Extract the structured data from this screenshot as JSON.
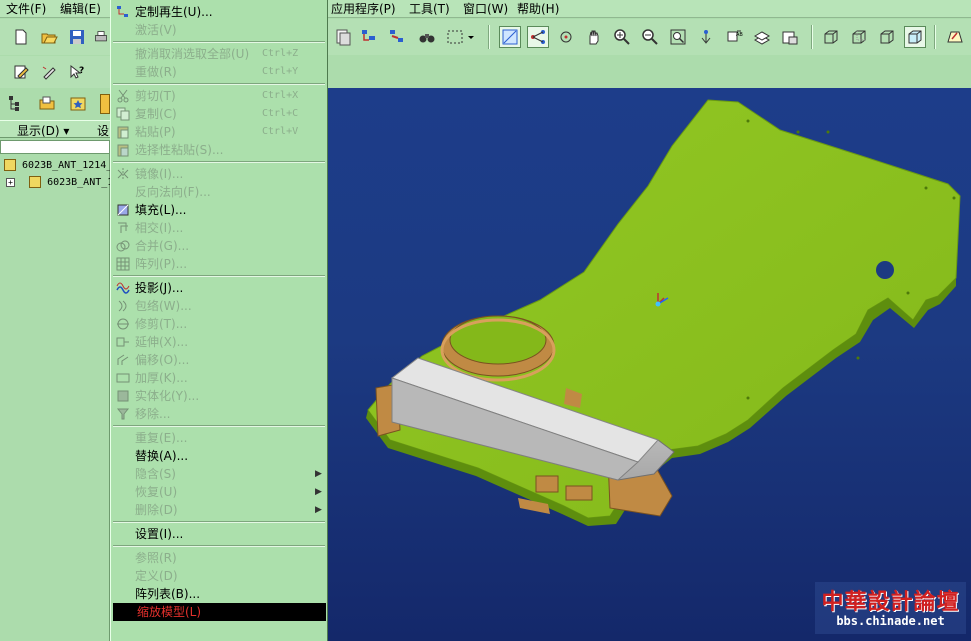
{
  "menubar": {
    "file": "文件(F)",
    "edit": "编辑(E)",
    "applications": "应用程序(P)",
    "tools": "工具(T)",
    "window": "窗口(W)",
    "help": "帮助(H)"
  },
  "left_panel": {
    "show_button": "显示(D) ▾",
    "settings_button": "设",
    "tree_items": [
      "6023B_ANT_1214_",
      "6023B_ANT_1"
    ]
  },
  "edit_menu": {
    "items": [
      {
        "label": "定制再生(U)...",
        "shortcut": "",
        "enabled": true,
        "icon": "regenerate-icon"
      },
      {
        "label": "激活(V)",
        "shortcut": "",
        "enabled": false,
        "icon": ""
      },
      {
        "sep": true
      },
      {
        "label": "撤消取消选取全部(U)",
        "shortcut": "Ctrl+Z",
        "enabled": false,
        "icon": ""
      },
      {
        "label": "重做(R)",
        "shortcut": "Ctrl+Y",
        "enabled": false,
        "icon": ""
      },
      {
        "sep": true
      },
      {
        "label": "剪切(T)",
        "shortcut": "Ctrl+X",
        "enabled": false,
        "icon": "scissors-icon"
      },
      {
        "label": "复制(C)",
        "shortcut": "Ctrl+C",
        "enabled": false,
        "icon": "copy-icon"
      },
      {
        "label": "粘贴(P)",
        "shortcut": "Ctrl+V",
        "enabled": false,
        "icon": "paste-icon"
      },
      {
        "label": "选择性粘贴(S)...",
        "shortcut": "",
        "enabled": false,
        "icon": "paste-special-icon"
      },
      {
        "sep": true
      },
      {
        "label": "镜像(I)...",
        "shortcut": "",
        "enabled": false,
        "icon": "mirror-icon"
      },
      {
        "label": "反向法向(F)...",
        "shortcut": "",
        "enabled": false,
        "icon": ""
      },
      {
        "label": "填充(L)...",
        "shortcut": "",
        "enabled": true,
        "icon": "fill-icon"
      },
      {
        "label": "相交(I)...",
        "shortcut": "",
        "enabled": false,
        "icon": "intersect-icon"
      },
      {
        "label": "合并(G)...",
        "shortcut": "",
        "enabled": false,
        "icon": "merge-icon"
      },
      {
        "label": "阵列(P)...",
        "shortcut": "",
        "enabled": false,
        "icon": "pattern-icon"
      },
      {
        "sep": true
      },
      {
        "label": "投影(J)...",
        "shortcut": "",
        "enabled": true,
        "icon": "project-icon"
      },
      {
        "label": "包络(W)...",
        "shortcut": "",
        "enabled": false,
        "icon": "wrap-icon"
      },
      {
        "label": "修剪(T)...",
        "shortcut": "",
        "enabled": false,
        "icon": "trim-icon"
      },
      {
        "label": "延伸(X)...",
        "shortcut": "",
        "enabled": false,
        "icon": "extend-icon"
      },
      {
        "label": "偏移(O)...",
        "shortcut": "",
        "enabled": false,
        "icon": "offset-icon"
      },
      {
        "label": "加厚(K)...",
        "shortcut": "",
        "enabled": false,
        "icon": "thicken-icon"
      },
      {
        "label": "实体化(Y)...",
        "shortcut": "",
        "enabled": false,
        "icon": "solidify-icon"
      },
      {
        "label": "移除...",
        "shortcut": "",
        "enabled": false,
        "icon": "remove-icon"
      },
      {
        "sep": true
      },
      {
        "label": "重复(E)...",
        "shortcut": "",
        "enabled": false,
        "icon": ""
      },
      {
        "label": "替换(A)...",
        "shortcut": "",
        "enabled": true,
        "icon": ""
      },
      {
        "label": "隐含(S)",
        "shortcut": "",
        "enabled": false,
        "icon": "",
        "submenu": true
      },
      {
        "label": "恢复(U)",
        "shortcut": "",
        "enabled": false,
        "icon": "",
        "submenu": true
      },
      {
        "label": "删除(D)",
        "shortcut": "",
        "enabled": false,
        "icon": "",
        "submenu": true
      },
      {
        "sep": true
      },
      {
        "label": "设置(I)...",
        "shortcut": "",
        "enabled": true,
        "icon": ""
      },
      {
        "sep": true
      },
      {
        "label": "参照(R)",
        "shortcut": "",
        "enabled": false,
        "icon": ""
      },
      {
        "label": "定义(D)",
        "shortcut": "",
        "enabled": false,
        "icon": ""
      },
      {
        "label": "阵列表(B)...",
        "shortcut": "",
        "enabled": true,
        "icon": ""
      },
      {
        "label": "缩放模型(L)",
        "shortcut": "",
        "enabled": true,
        "icon": "",
        "highlighted": true
      }
    ]
  },
  "watermark": {
    "title": "中華設計論壇",
    "url": "bbs.chinade.net"
  },
  "colors": {
    "ui_green": "#acdcac",
    "viewport_blue": "#1c3a82",
    "model_green": "#8cc21e",
    "model_tan": "#c08a44",
    "highlight_text": "#e2302c"
  }
}
